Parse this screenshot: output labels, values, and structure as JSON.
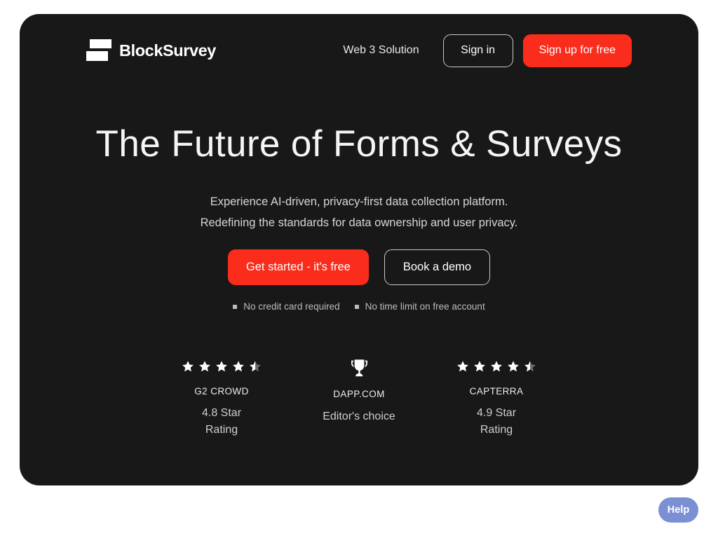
{
  "theme": {
    "page_background": "#ffffff",
    "card_background": "#181818",
    "accent_red": "#fa2d1d",
    "help_blue": "#7b8fd4",
    "text_primary": "#f5f5f5",
    "text_muted": "#bdbdbd"
  },
  "header": {
    "brand_name": "BlockSurvey",
    "logo_icon": "blocksurvey-bars-logo",
    "nav_link": "Web 3 Solution",
    "sign_in_label": "Sign in",
    "sign_up_label": "Sign up for free"
  },
  "hero": {
    "headline": "The Future of Forms & Surveys",
    "subhead_line_1": "Experience AI-driven, privacy-first data collection platform.",
    "subhead_line_2": "Redefining the standards for data ownership and user privacy.",
    "primary_cta": "Get started - it's free",
    "secondary_cta": "Book a demo",
    "perks": [
      {
        "label": "No credit card required"
      },
      {
        "label": "No time limit on free account"
      }
    ]
  },
  "badges": [
    {
      "icon": "star-rating",
      "stars_total": 5,
      "stars_filled": 4,
      "stars_half": 1,
      "title": "G2 CROWD",
      "subtitle_line_1": "4.8 Star",
      "subtitle_line_2": "Rating",
      "rating": 4.8
    },
    {
      "icon": "trophy-icon",
      "title": "DAPP.COM",
      "subtitle_line_1": "Editor's choice",
      "subtitle_line_2": ""
    },
    {
      "icon": "star-rating",
      "stars_total": 5,
      "stars_filled": 4,
      "stars_half": 1,
      "title": "CAPTERRA",
      "subtitle_line_1": "4.9 Star",
      "subtitle_line_2": "Rating",
      "rating": 4.9
    }
  ],
  "help_widget": {
    "label": "Help"
  }
}
